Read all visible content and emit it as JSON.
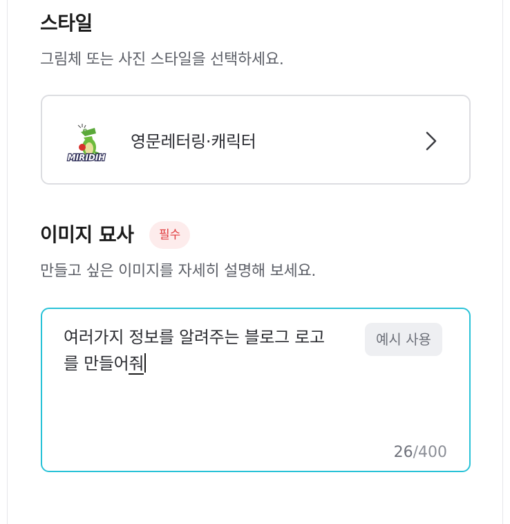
{
  "style_section": {
    "title": "스타일",
    "description": "그림체 또는 사진 스타일을 선택하세요.",
    "selected_style": {
      "name": "영문레터링·캐릭터",
      "thumbnail_text": "MIRIDIH",
      "thumbnail_icon": "crocodile-mascot-icon",
      "chevron_icon": "chevron-right-icon"
    }
  },
  "description_section": {
    "title": "이미지 묘사",
    "required_badge": "필수",
    "description": "만들고 싶은 이미지를 자세히 설명해 보세요.",
    "textarea": {
      "value_committed": "여러가지 정보를 알려주는 블로그 로고\n를 만들어",
      "value_composing": "줘",
      "example_button": "예시 사용",
      "count_current": "26",
      "count_separator": "/",
      "count_max": "400"
    }
  },
  "colors": {
    "focus_border": "#28c2d7",
    "required_text": "#e0393b",
    "required_bg": "#fdecec"
  }
}
